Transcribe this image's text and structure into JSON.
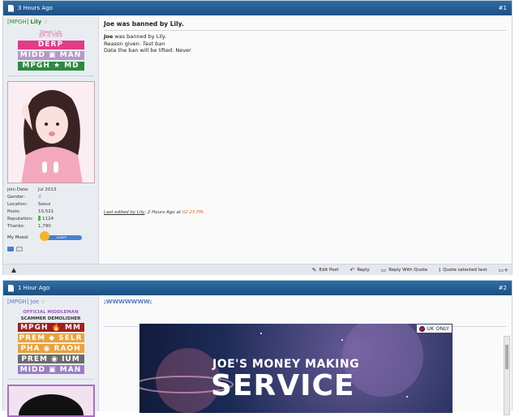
{
  "posts": [
    {
      "time": "3 Hours Ago",
      "number": "#1",
      "user": {
        "tag": "[MPGH]",
        "name": "Lily",
        "caption": "Sleepy Lily",
        "caption_sub": "蓝色 忍 月雪花",
        "ranks": [
          {
            "label": "DERP",
            "color": "#e43a88"
          },
          {
            "label": "MIDD ▣ MAN",
            "color": "#b39bc9"
          },
          {
            "label": "MPGH ★ MD",
            "color": "#2b8a3e"
          }
        ],
        "stats": [
          {
            "key": "Join Date:",
            "value": "Jul 2013"
          },
          {
            "key": "Gender:",
            "value": "♀"
          },
          {
            "key": "Location:",
            "value": "Seoul"
          },
          {
            "key": "Posts:",
            "value": "10,521"
          },
          {
            "key": "Reputation:",
            "value": "1124"
          },
          {
            "key": "Thanks:",
            "value": "1,790"
          }
        ],
        "mood_label": "My Mood:",
        "mood_value": "SLEEPY"
      },
      "title": "Joe was banned by Lily.",
      "lines": {
        "banned_name": "Joe",
        "banned_text": " was banned by Lily.",
        "reason_label": "Reason given: ",
        "reason_value": "Test ban",
        "lift": "Date the ban will be lifted: Never"
      },
      "edited": {
        "prefix": "Last edited by Lily",
        "middle": "; 2 Hours Ago at ",
        "time": "02:23 PM",
        "suffix": "."
      },
      "footer": {
        "edit": "Edit Post",
        "reply": "Reply",
        "reply_quote": "Reply With Quote",
        "quote_selected": "Quote selected text"
      }
    },
    {
      "time": "1 Hour Ago",
      "number": "#2",
      "user": {
        "tag": "[MPGH]",
        "name": "Joe",
        "caption": "OFFICIAL MIDDLEMAN",
        "caption_sub": "SCAMMER DEMOLISHER",
        "ranks": [
          {
            "label": "MPGH 🔥 MM",
            "color": "#a31e1e"
          },
          {
            "label": "PREM ◆ SELR",
            "color": "#e8a33d"
          },
          {
            "label": "PHA ◉ RAOH",
            "color": "#e8a33d"
          },
          {
            "label": "PREM ◉ IUM",
            "color": "#6b6b6b"
          },
          {
            "label": "MIDD ▣ MAN",
            "color": "#9a7fc2"
          }
        ]
      },
      "message": ";WWWWWWW;",
      "promo": {
        "region": "UK ONLY",
        "headline": "JOE'S MONEY MAKING",
        "big": "SERVICE"
      }
    }
  ]
}
